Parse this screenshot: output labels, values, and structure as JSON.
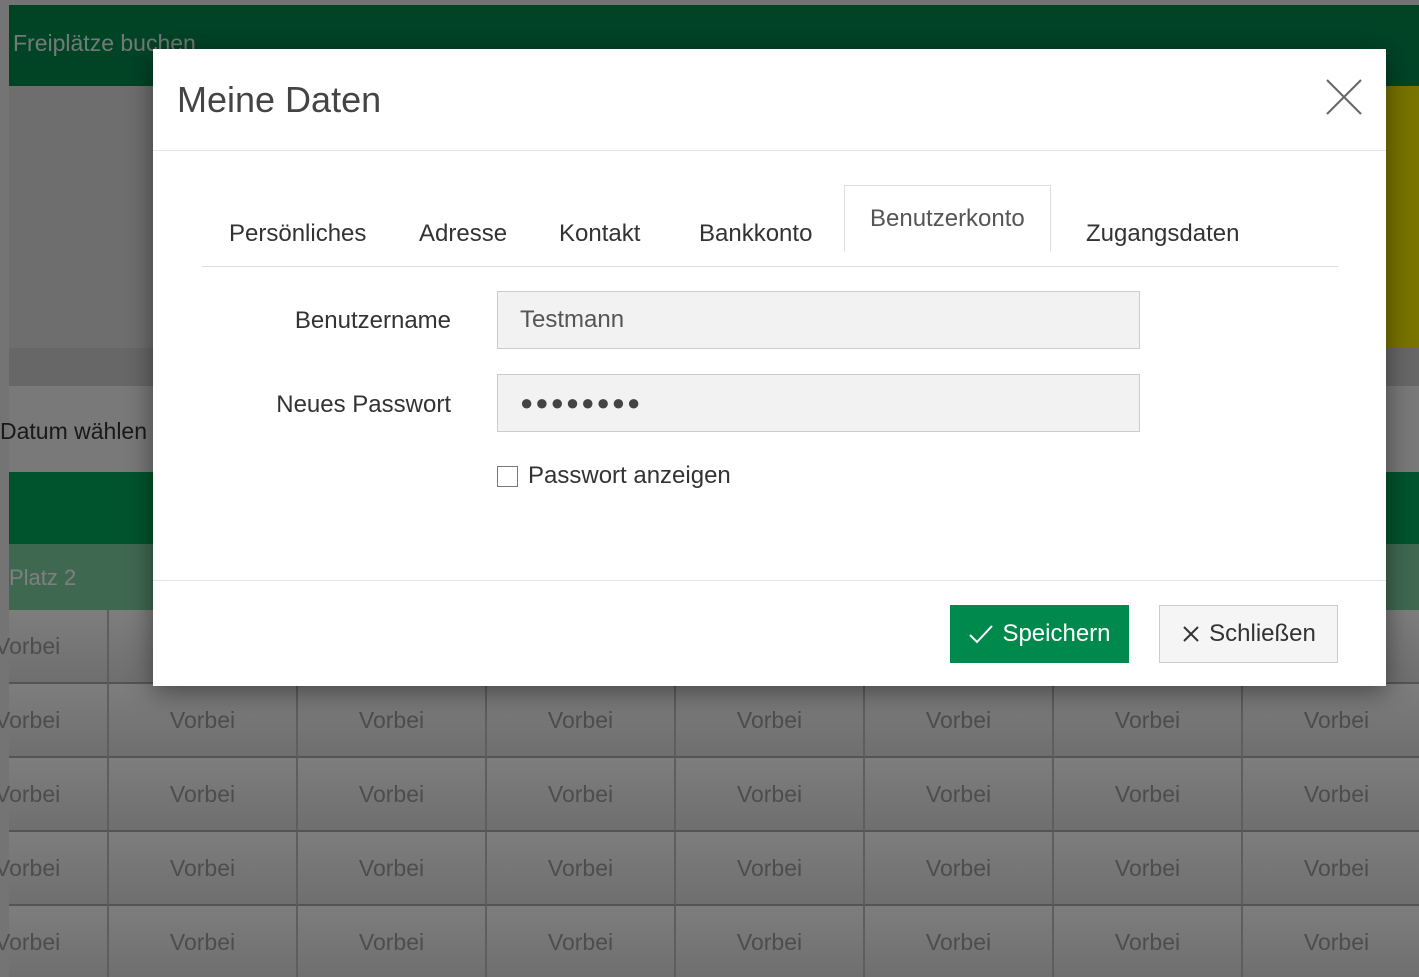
{
  "background": {
    "page_title": "Freiplätze buchen",
    "date_label": "Datum wählen",
    "column_label": "Platz 2",
    "cell_text": "Vorbei",
    "rows": 5,
    "cols": 8
  },
  "modal": {
    "title": "Meine Daten",
    "tabs": [
      {
        "label": "Persönliches",
        "active": false
      },
      {
        "label": "Adresse",
        "active": false
      },
      {
        "label": "Kontakt",
        "active": false
      },
      {
        "label": "Bankkonto",
        "active": false
      },
      {
        "label": "Benutzerkonto",
        "active": true
      },
      {
        "label": "Zugangsdaten",
        "active": false
      }
    ],
    "form": {
      "username_label": "Benutzername",
      "username_value": "Testmann",
      "password_label": "Neues Passwort",
      "password_value": "●●●●●●●●",
      "show_password_label": "Passwort anzeigen",
      "show_password_checked": false
    },
    "buttons": {
      "save_label": "Speichern",
      "close_label": "Schließen"
    }
  },
  "colors": {
    "brand_green": "#00894c",
    "accent_yellow": "#f2e600"
  },
  "icons": {
    "close": "close-icon",
    "save": "checkmark-icon",
    "dismiss": "x-icon"
  }
}
